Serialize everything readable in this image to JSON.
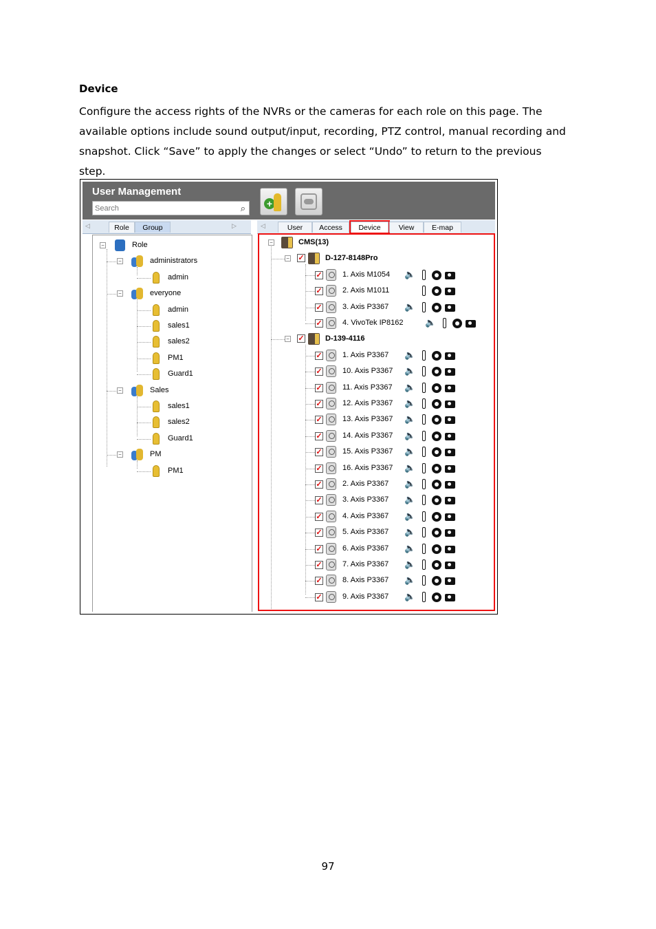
{
  "doc": {
    "heading": "Device",
    "paragraph_lines": [
      "Configure the access rights of the NVRs or the cameras for each role on this page. The",
      "available options include sound output/input, recording, PTZ control, manual recording and",
      "snapshot.   Click “Save” to apply the changes or select “Undo” to return to the previous",
      "step."
    ],
    "page_number": "97"
  },
  "app": {
    "title": "User Management",
    "search_placeholder": "Search",
    "left_tabs": [
      "Role",
      "Group"
    ],
    "right_tabs": [
      "User",
      "Access",
      "Device",
      "View",
      "E-map"
    ],
    "active_right_tab": "Device"
  },
  "role_tree": {
    "root": "Role",
    "groups": [
      {
        "name": "administrators",
        "users": [
          "admin"
        ]
      },
      {
        "name": "everyone",
        "users": [
          "admin",
          "sales1",
          "sales2",
          "PM1",
          "Guard1"
        ]
      },
      {
        "name": "Sales",
        "users": [
          "sales1",
          "sales2",
          "Guard1"
        ]
      },
      {
        "name": "PM",
        "users": [
          "PM1"
        ]
      }
    ]
  },
  "device_tree": {
    "root": "CMS(13)",
    "nvrs": [
      {
        "name": "D-127-8148Pro",
        "cameras": [
          {
            "name": "1. Axis M1054",
            "icons": [
              "sound",
              "ptz",
              "record",
              "snapshot"
            ]
          },
          {
            "name": "2. Axis M1011",
            "icons": [
              "ptz",
              "record",
              "snapshot"
            ]
          },
          {
            "name": "3. Axis P3367",
            "icons": [
              "sound",
              "ptz",
              "record",
              "snapshot"
            ]
          },
          {
            "name": "4. VivoTek IP8162",
            "icons": [
              "sound",
              "ptz",
              "record",
              "snapshot"
            ]
          }
        ]
      },
      {
        "name": "D-139-4116",
        "cameras": [
          {
            "name": "1. Axis P3367",
            "icons": [
              "sound",
              "ptz",
              "record",
              "snapshot"
            ]
          },
          {
            "name": "10. Axis P3367",
            "icons": [
              "sound",
              "ptz",
              "record",
              "snapshot"
            ]
          },
          {
            "name": "11. Axis P3367",
            "icons": [
              "sound",
              "ptz",
              "record",
              "snapshot"
            ]
          },
          {
            "name": "12. Axis P3367",
            "icons": [
              "sound",
              "ptz",
              "record",
              "snapshot"
            ]
          },
          {
            "name": "13. Axis P3367",
            "icons": [
              "sound",
              "ptz",
              "record",
              "snapshot"
            ]
          },
          {
            "name": "14. Axis P3367",
            "icons": [
              "sound",
              "ptz",
              "record",
              "snapshot"
            ]
          },
          {
            "name": "15. Axis P3367",
            "icons": [
              "sound",
              "ptz",
              "record",
              "snapshot"
            ]
          },
          {
            "name": "16. Axis P3367",
            "icons": [
              "sound",
              "ptz",
              "record",
              "snapshot"
            ]
          },
          {
            "name": "2. Axis P3367",
            "icons": [
              "sound",
              "ptz",
              "record",
              "snapshot"
            ]
          },
          {
            "name": "3. Axis P3367",
            "icons": [
              "sound",
              "ptz",
              "record",
              "snapshot"
            ]
          },
          {
            "name": "4. Axis P3367",
            "icons": [
              "sound",
              "ptz",
              "record",
              "snapshot"
            ]
          },
          {
            "name": "5. Axis P3367",
            "icons": [
              "sound",
              "ptz",
              "record",
              "snapshot"
            ]
          },
          {
            "name": "6. Axis P3367",
            "icons": [
              "sound",
              "ptz",
              "record",
              "snapshot"
            ]
          },
          {
            "name": "7. Axis P3367",
            "icons": [
              "sound",
              "ptz",
              "record",
              "snapshot"
            ]
          },
          {
            "name": "8. Axis P3367",
            "icons": [
              "sound",
              "ptz",
              "record",
              "snapshot"
            ]
          },
          {
            "name": "9. Axis P3367",
            "icons": [
              "sound",
              "ptz",
              "record",
              "snapshot"
            ]
          }
        ]
      }
    ]
  },
  "colors": {
    "highlight": "#ee1111",
    "header": "#6a6a6a"
  }
}
